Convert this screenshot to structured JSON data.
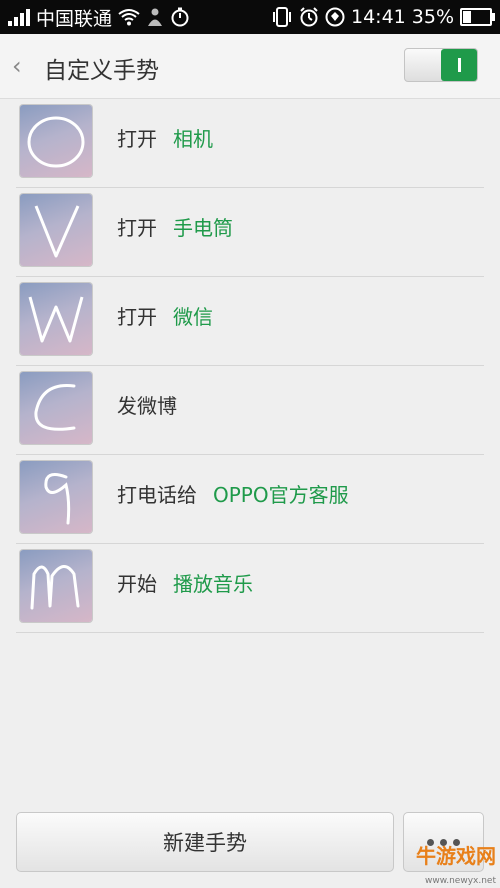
{
  "status_bar": {
    "carrier": "中国联通",
    "time": "14:41",
    "battery": "35%",
    "battery_level": 0.35,
    "icons": [
      "signal-icon",
      "wifi-icon",
      "usb-debug-icon",
      "stopwatch-icon",
      "vibrate-icon",
      "alarm-icon",
      "app-notification-icon",
      "battery-icon"
    ]
  },
  "header": {
    "back_icon": "‹",
    "title": "自定义手势",
    "toggle_on": true
  },
  "gestures": [
    {
      "symbol": "O",
      "action": "打开",
      "target": "相机"
    },
    {
      "symbol": "V",
      "action": "打开",
      "target": "手电筒"
    },
    {
      "symbol": "W",
      "action": "打开",
      "target": "微信"
    },
    {
      "symbol": "C",
      "action": "发微博",
      "target": ""
    },
    {
      "symbol": "9",
      "action": "打电话给",
      "target": "OPPO官方客服"
    },
    {
      "symbol": "M",
      "action": "开始",
      "target": "播放音乐"
    }
  ],
  "footer": {
    "new_label": "新建手势",
    "more_icon": "more-icon"
  },
  "watermark": {
    "logo": "牛游戏网",
    "url": "www.newyx.net"
  },
  "colors": {
    "accent_green": "#1f9a4a",
    "statusbar_bg": "#0a0a0a",
    "page_bg": "#efefef"
  }
}
